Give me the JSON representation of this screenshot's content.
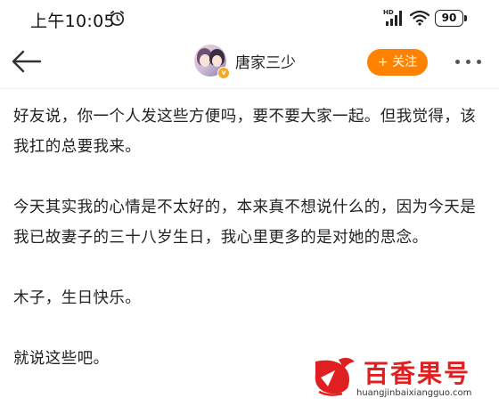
{
  "status_bar": {
    "time": "上午10:05",
    "battery": "90",
    "icons": [
      "alarm-icon",
      "hd-signal-icon",
      "wifi-icon",
      "battery-icon"
    ]
  },
  "nav": {
    "back_icon": "arrow-left-icon",
    "username": "唐家三少",
    "follow_label": "+ 关注",
    "more_icon": "more-dots-icon",
    "accent": "#ff8200"
  },
  "post": {
    "paragraphs": [
      "好友说，你一个人发这些方便吗，要不要大家一起。但我觉得，该我扛的总要我来。",
      "今天其实我的心情是不太好的，本来真不想说什么的，因为今天是我已故妻子的三十八岁生日，我心里更多的是对她的思念。",
      "木子，生日快乐。",
      "就说这些吧。"
    ]
  },
  "watermark": {
    "title": "百香果号",
    "url": "huangjinbaixiangguo.com",
    "color": "#e02020"
  }
}
